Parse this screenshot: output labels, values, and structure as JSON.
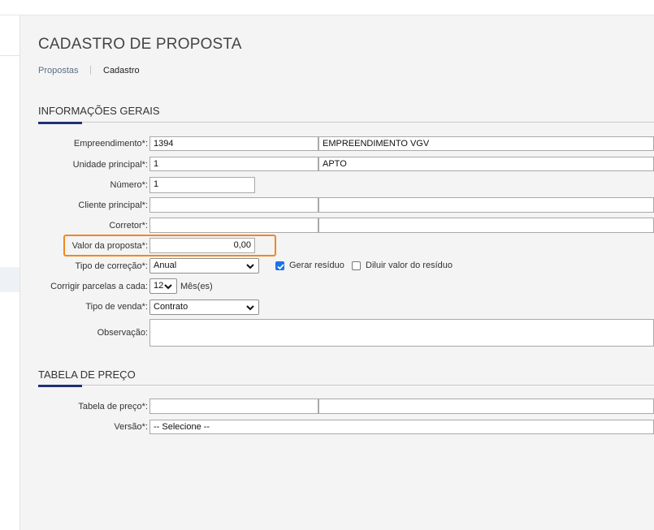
{
  "page": {
    "title": "CADASTRO DE PROPOSTA",
    "breadcrumb": {
      "link": "Propostas",
      "divider": "|",
      "current": "Cadastro"
    }
  },
  "general": {
    "title": "INFORMAÇÕES GERAIS",
    "empreendimento": {
      "label": "Empreendimento*:",
      "code": "1394",
      "name": "EMPREENDIMENTO VGV"
    },
    "unidade": {
      "label": "Unidade principal*:",
      "code": "1",
      "name": "APTO"
    },
    "numero": {
      "label": "Número*:",
      "value": "1"
    },
    "cliente": {
      "label": "Cliente principal*:",
      "code": "",
      "name": ""
    },
    "corretor": {
      "label": "Corretor*:",
      "code": "",
      "name": ""
    },
    "valor": {
      "label": "Valor da proposta*:",
      "value": "0,00"
    },
    "tipo_correcao": {
      "label": "Tipo de correção*:",
      "selected": "Anual"
    },
    "gerar_residuo": {
      "label": "Gerar resíduo",
      "checked": true
    },
    "diluir_residuo": {
      "label": "Diluir valor do resíduo",
      "checked": false
    },
    "corrigir": {
      "label": "Corrigir parcelas a cada:",
      "selected": "12",
      "unit": "Mês(es)"
    },
    "tipo_venda": {
      "label": "Tipo de venda*:",
      "selected": "Contrato"
    },
    "observacao": {
      "label": "Observação:",
      "value": ""
    }
  },
  "price_table": {
    "title": "TABELA DE PREÇO",
    "tabela": {
      "label": "Tabela de preço*:",
      "code": "",
      "name": ""
    },
    "versao": {
      "label": "Versão*:",
      "selected": "-- Selecione --"
    }
  },
  "colors": {
    "accent": "#1f3276",
    "highlight": "#f0891e",
    "checkbox": "#1a73e8"
  }
}
